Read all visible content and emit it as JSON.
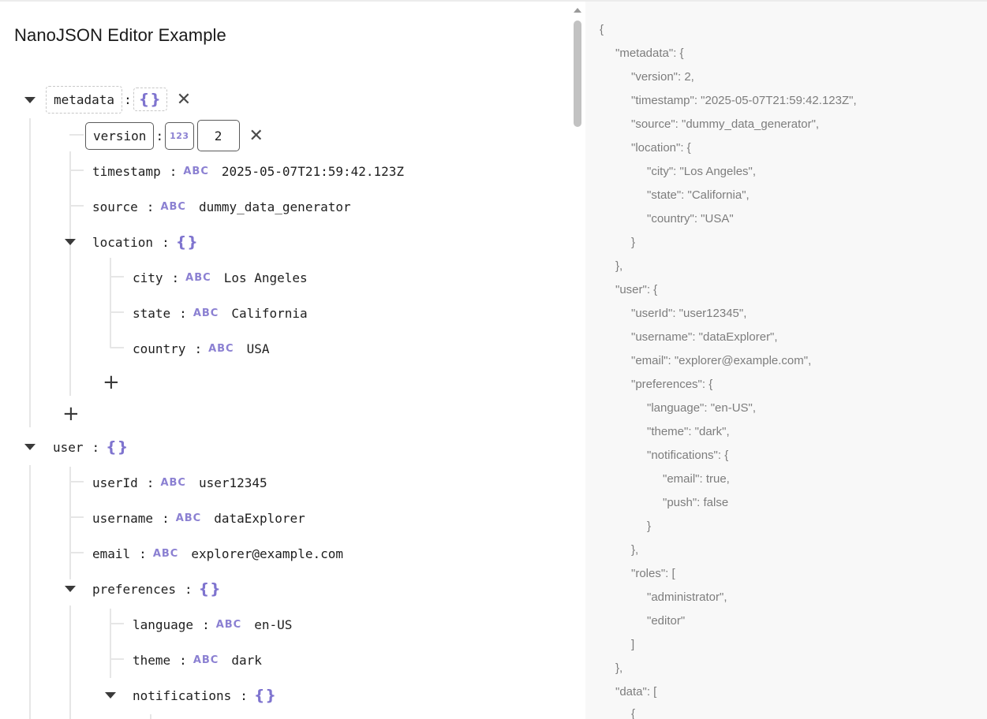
{
  "page": {
    "title": "NanoJSON Editor Example"
  },
  "type_badges": {
    "string": "ABC",
    "number": "123",
    "object": "{}"
  },
  "tree": {
    "metadata": {
      "key": "metadata",
      "version": {
        "key": "version",
        "value": "2"
      },
      "timestamp": {
        "key": "timestamp",
        "value": "2025-05-07T21:59:42.123Z"
      },
      "source": {
        "key": "source",
        "value": "dummy_data_generator"
      },
      "location": {
        "key": "location",
        "city": {
          "key": "city",
          "value": "Los Angeles"
        },
        "state": {
          "key": "state",
          "value": "California"
        },
        "country": {
          "key": "country",
          "value": "USA"
        }
      }
    },
    "user": {
      "key": "user",
      "userId": {
        "key": "userId",
        "value": "user12345"
      },
      "username": {
        "key": "username",
        "value": "dataExplorer"
      },
      "email": {
        "key": "email",
        "value": "explorer@example.com"
      },
      "preferences": {
        "key": "preferences",
        "language": {
          "key": "language",
          "value": "en-US"
        },
        "theme": {
          "key": "theme",
          "value": "dark"
        },
        "notifications": {
          "key": "notifications"
        }
      }
    }
  },
  "raw_json_lines": [
    "{",
    "\"metadata\": {",
    "\"version\": 2,",
    "\"timestamp\": \"2025-05-07T21:59:42.123Z\",",
    "\"source\": \"dummy_data_generator\",",
    "\"location\": {",
    "\"city\": \"Los Angeles\",",
    "\"state\": \"California\",",
    "\"country\": \"USA\"",
    "}",
    "},",
    "\"user\": {",
    "\"userId\": \"user12345\",",
    "\"username\": \"dataExplorer\",",
    "\"email\": \"explorer@example.com\",",
    "\"preferences\": {",
    "\"language\": \"en-US\",",
    "\"theme\": \"dark\",",
    "\"notifications\": {",
    "\"email\": true,",
    "\"push\": false",
    "}",
    "},",
    "\"roles\": [",
    "\"administrator\",",
    "\"editor\"",
    "]",
    "},",
    "\"data\": [",
    "{"
  ]
}
